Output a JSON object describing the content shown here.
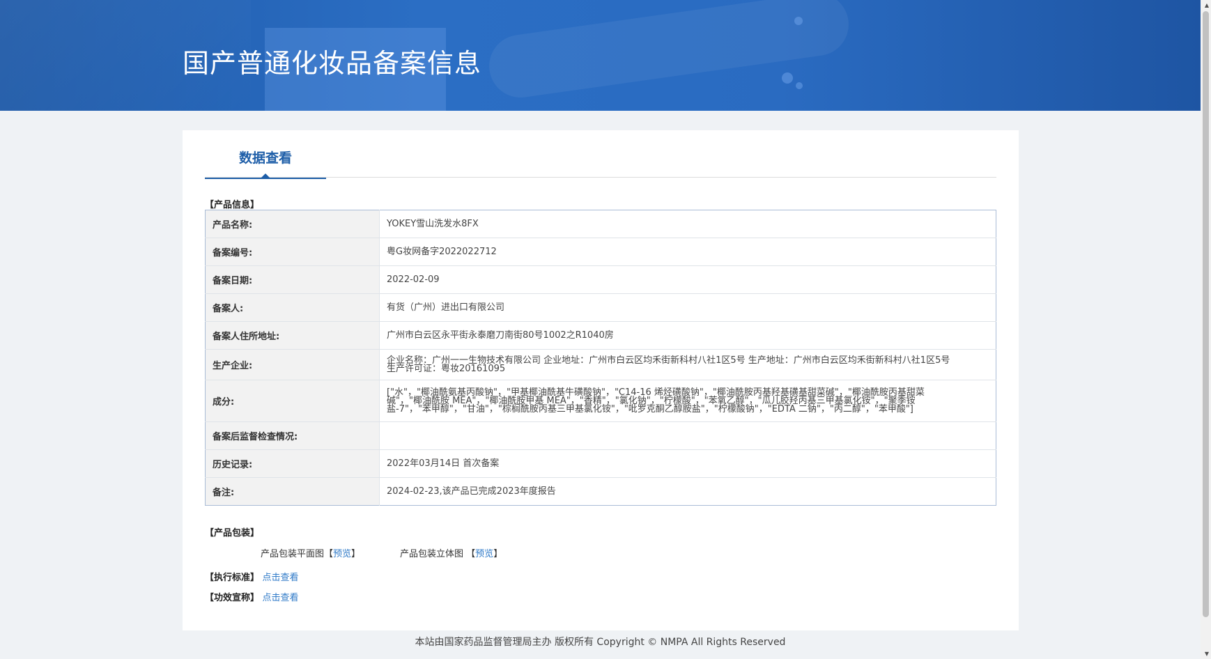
{
  "header": {
    "title": "国产普通化妆品备案信息"
  },
  "tabs": {
    "active_label": "数据查看"
  },
  "product_info": {
    "section_title": "【产品信息】",
    "rows": [
      {
        "label": "产品名称:",
        "value": "YOKEY雪山洗发水8FX"
      },
      {
        "label": "备案编号:",
        "value": "粤G妆网备字2022022712"
      },
      {
        "label": "备案日期:",
        "value": "2022-02-09"
      },
      {
        "label": "备案人:",
        "value": "有货（广州）进出口有限公司"
      },
      {
        "label": "备案人住所地址:",
        "value": "广州市白云区永平街永泰磨刀南街80号1002之R1040房"
      },
      {
        "label": "生产企业:",
        "value": "企业名称：广州一一生物技术有限公司 企业地址：广州市白云区均禾街新科村八社1区5号 生产地址：广州市白云区均禾街新科村八社1区5号 生产许可证：粤妆20161095"
      },
      {
        "label": "成分:",
        "value": "[\"水\"，\"椰油酰氨基丙酸钠\"，\"甲基椰油酰基牛磺酸钠\"，\"C14-16 烯烃磺酸钠\"，\"椰油酰胺丙基羟基磺基甜菜碱\"，\"椰油酰胺丙基甜菜碱\"，\"椰油酰胺 MEA\"，\"椰油酰胺甲基 MEA\"，\"香精\"，\"氯化钠\"，\"柠檬酸\"，\"苯氧乙醇\"，\"瓜儿胶羟丙基三甲基氯化铵\"，\"聚季铵盐-7\"，\"苯甲醇\"，\"甘油\"，\"棕榈酰胺丙基三甲基氯化铵\"，\"吡罗克酮乙醇胺盐\"，\"柠檬酸钠\"，\"EDTA 二钠\"，\"丙二醇\"，\"苯甲酸\"]"
      },
      {
        "label": "备案后监督检查情况:",
        "value": ""
      },
      {
        "label": "历史记录:",
        "value": "2022年03月14日 首次备案"
      },
      {
        "label": "备注:",
        "value": "2024-02-23,该产品已完成2023年度报告"
      }
    ]
  },
  "packaging": {
    "section_title": "【产品包装】",
    "flat_label": "产品包装平面图",
    "three_d_label": "产品包装立体图",
    "bracket_open": "【",
    "bracket_close": "】",
    "preview_link": "预览"
  },
  "standard": {
    "section_title": "【执行标准】",
    "link": "点击查看"
  },
  "efficacy": {
    "section_title": "【功效宣称】",
    "link": "点击查看"
  },
  "footer": {
    "text": "本站由国家药品监督管理局主办 版权所有 Copyright © NMPA All Rights Reserved"
  }
}
